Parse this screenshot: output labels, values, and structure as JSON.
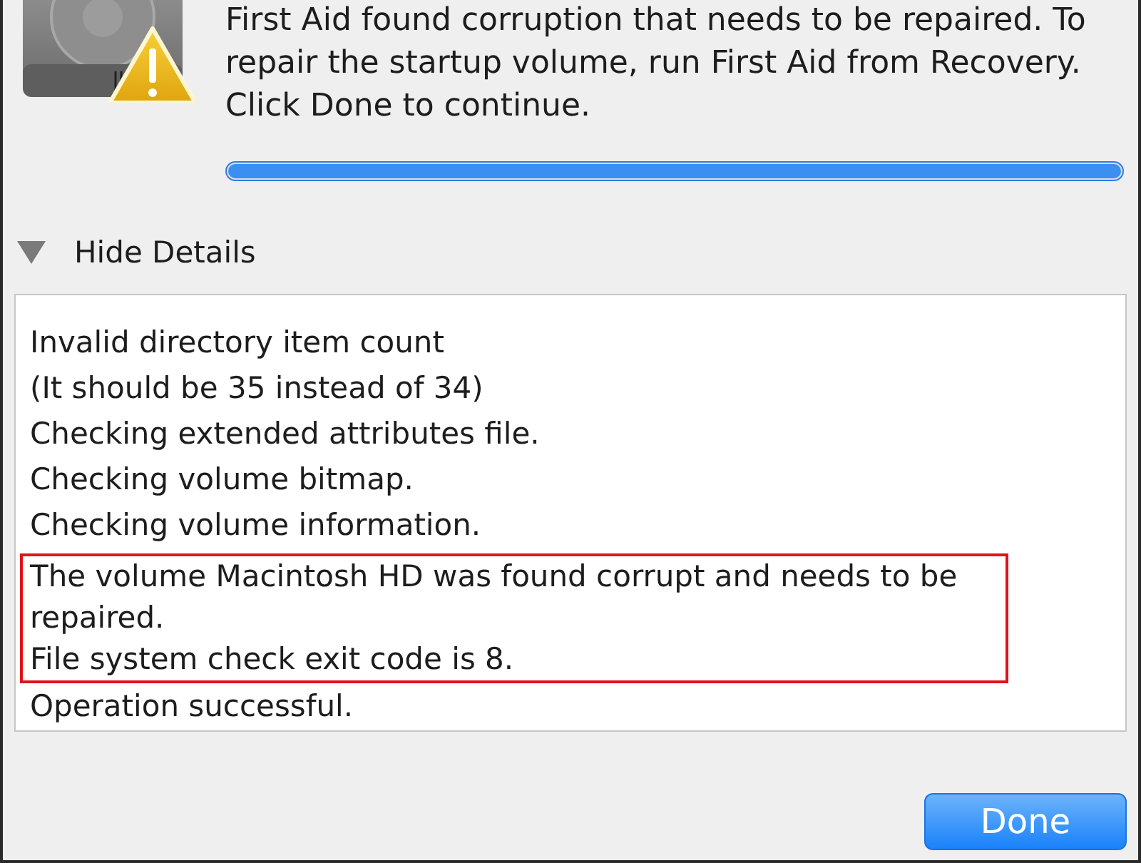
{
  "message": "First Aid found corruption that needs to be repaired. To repair the startup volume, run First Aid from Recovery. Click Done to continue.",
  "progress": {
    "level": 1
  },
  "details": {
    "label": "Hide Details",
    "expanded": true,
    "log": [
      {
        "text": "Invalid directory item count",
        "highlighted": false
      },
      {
        "text": "(It should be 35 instead of 34)",
        "highlighted": false
      },
      {
        "text": "Checking extended attributes file.",
        "highlighted": false
      },
      {
        "text": "Checking volume bitmap.",
        "highlighted": false
      },
      {
        "text": "Checking volume information.",
        "highlighted": false
      },
      {
        "text": "The volume Macintosh HD was found corrupt and needs to be repaired.",
        "highlighted": true
      },
      {
        "text": "File system check exit code is 8.",
        "highlighted": true
      },
      {
        "text": "Operation successful.",
        "highlighted": false
      }
    ]
  },
  "buttons": [
    {
      "label": "Done",
      "default": true
    }
  ]
}
